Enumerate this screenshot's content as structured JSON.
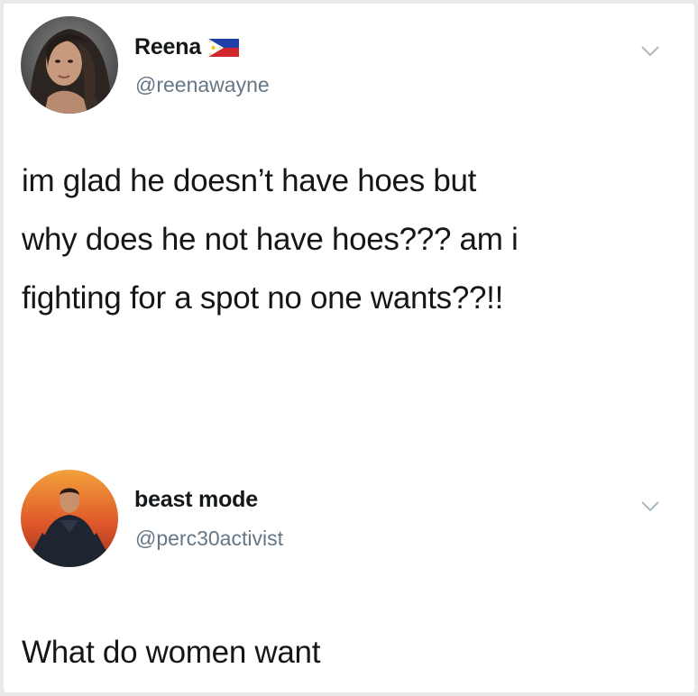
{
  "tweets": [
    {
      "display_name": "Reena",
      "handle": "@reenawayne",
      "badge_icon": "philippines-flag-icon",
      "avatar_icon": "profile-photo-woman",
      "text_lines": [
        "im glad he doesn’t have hoes but",
        "why does he not have hoes??? am i",
        "fighting for a spot no one wants??!!"
      ]
    },
    {
      "display_name": "beast mode",
      "handle": "@perc30activist",
      "avatar_icon": "profile-photo-superhero",
      "text_lines": [
        "What do women want"
      ]
    }
  ],
  "colors": {
    "name": "#14171a",
    "handle": "#657786",
    "chevron": "#aab8c2",
    "background": "#ffffff"
  }
}
